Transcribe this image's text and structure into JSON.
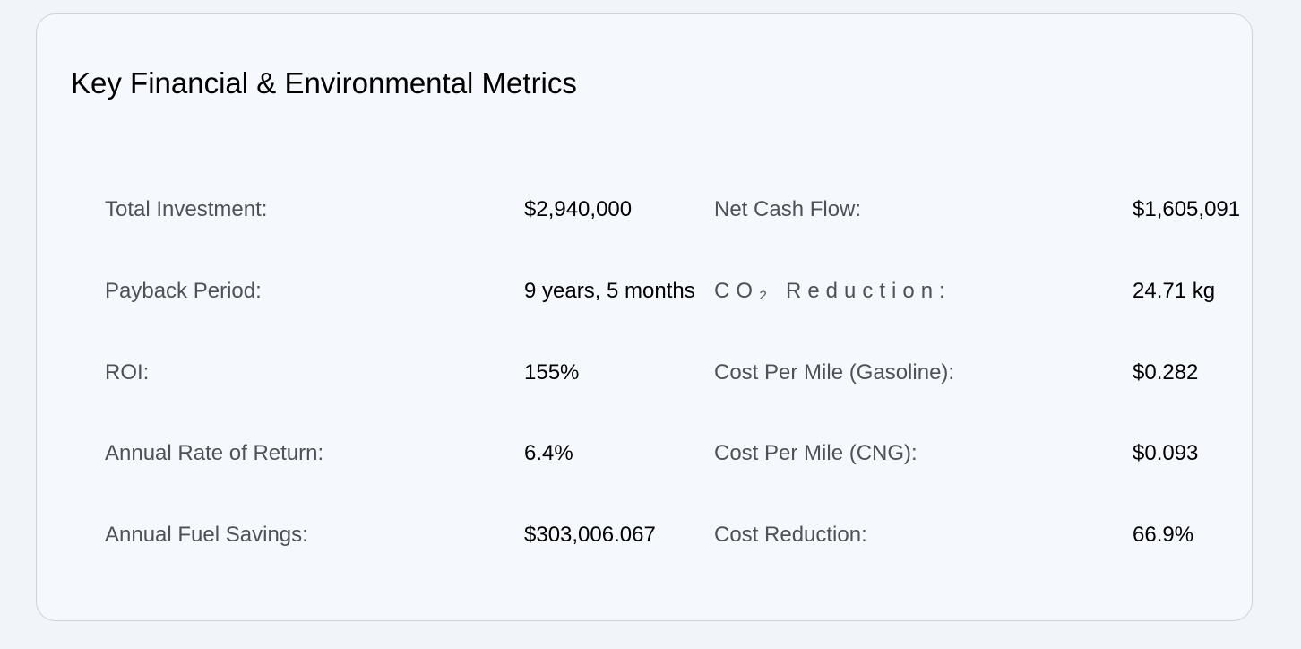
{
  "panel": {
    "title": "Key Financial & Environmental Metrics"
  },
  "metrics": {
    "total_investment": {
      "label": "Total Investment:",
      "value": "$2,940,000"
    },
    "net_cash_flow": {
      "label": "Net Cash Flow:",
      "value": "$1,605,091"
    },
    "payback_period": {
      "label": "Payback Period:",
      "value": "9 years, 5 months"
    },
    "co2_reduction": {
      "label": "CO₂ Reduction:",
      "value": "24.71 kg"
    },
    "roi": {
      "label": "ROI:",
      "value": "155%"
    },
    "cost_per_mile_gasoline": {
      "label": "Cost Per Mile (Gasoline):",
      "value": "$0.282"
    },
    "annual_rate_of_return": {
      "label": "Annual Rate of Return:",
      "value": "6.4%"
    },
    "cost_per_mile_cng": {
      "label": "Cost Per Mile (CNG):",
      "value": "$0.093"
    },
    "annual_fuel_savings": {
      "label": "Annual Fuel Savings:",
      "value": "$303,006.067"
    },
    "cost_reduction": {
      "label": "Cost Reduction:",
      "value": "66.9%"
    }
  }
}
